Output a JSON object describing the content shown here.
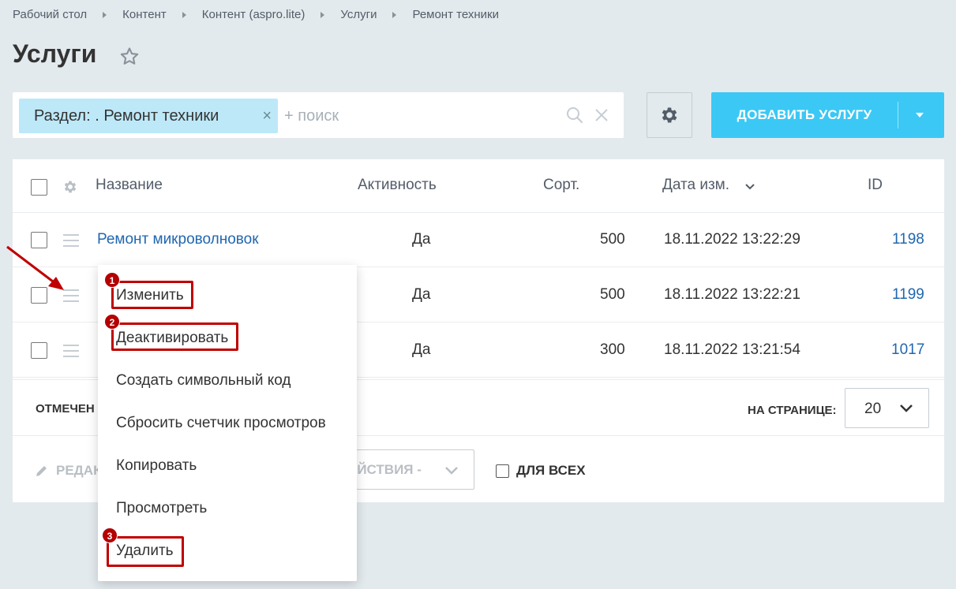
{
  "breadcrumb": [
    "Рабочий стол",
    "Контент",
    "Контент (aspro.lite)",
    "Услуги",
    "Ремонт техники"
  ],
  "page_title": "Услуги",
  "search": {
    "filter_tag": "Раздел: . Ремонт техники",
    "placeholder": "+ поиск"
  },
  "add_button": "ДОБАВИТЬ УСЛУГУ",
  "table": {
    "headers": {
      "name": "Название",
      "active": "Активность",
      "sort": "Сорт.",
      "date": "Дата изм.",
      "id": "ID"
    },
    "rows": [
      {
        "name": "Ремонт микроволновок",
        "active": "Да",
        "sort": "500",
        "date": "18.11.2022 13:22:29",
        "id": "1198"
      },
      {
        "name": "",
        "active": "Да",
        "sort": "500",
        "date": "18.11.2022 13:22:21",
        "id": "1199"
      },
      {
        "name": "",
        "active": "Да",
        "sort": "300",
        "date": "18.11.2022 13:21:54",
        "id": "1017"
      }
    ]
  },
  "footer": {
    "selected_label": "ОТМЕЧЕН",
    "per_page_label": "НА СТРАНИЦЕ:",
    "per_page_value": "20",
    "edit_label": "РЕДАК",
    "actions_label": "ЕЙСТВИЯ -",
    "for_all_label": "ДЛЯ ВСЕХ"
  },
  "context_menu": {
    "items": [
      "Изменить",
      "Деактивировать",
      "Создать символьный код",
      "Сбросить счетчик просмотров",
      "Копировать",
      "Просмотреть",
      "Удалить"
    ],
    "badges": [
      "1",
      "2",
      "3"
    ]
  },
  "colors": {
    "accent": "#3bc8f5",
    "link": "#2067b0",
    "highlight": "#c00000",
    "background": "#e3eaed"
  }
}
